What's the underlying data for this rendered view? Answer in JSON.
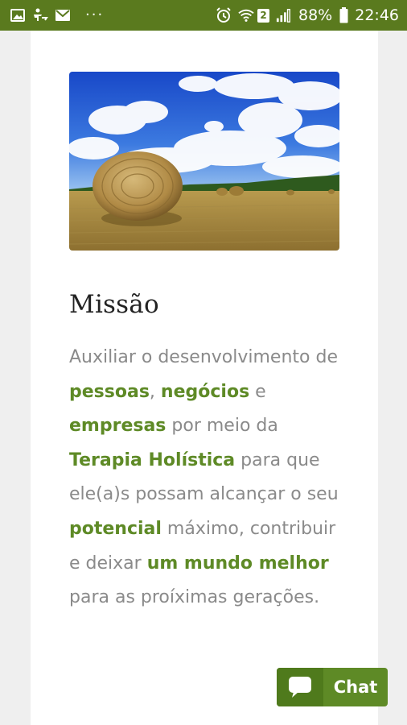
{
  "status_bar": {
    "icons_left": [
      "image-icon",
      "accessibility-icon",
      "mail-icon"
    ],
    "more": "···",
    "icons_right": [
      "alarm-icon",
      "wifi-icon",
      "signal-icon"
    ],
    "badge": "2",
    "battery": "88%",
    "time": "22:46"
  },
  "content": {
    "image_alt": "hay-bale-field",
    "heading": "Missão",
    "paragraph": {
      "t1": "Auxiliar o desenvolvimento de ",
      "h1": "pessoas",
      "t2": ", ",
      "h2": "negócios",
      "t3": " e ",
      "h3": "empresas",
      "t4": " por meio da ",
      "h4": "Terapia Holística",
      "t5": " para que ele(a)s possam alcançar o seu ",
      "h5": "potencial",
      "t6": " máximo, contribuir e deixar ",
      "h6": "um mundo melhor",
      "t7": " para as proíximas gerações."
    }
  },
  "chat": {
    "label": "Chat",
    "icon": "chat-bubble-icon"
  },
  "colors": {
    "status_bar": "#5a7a1e",
    "accent_green": "#5e8a26",
    "body_text": "#8a8a8a"
  }
}
